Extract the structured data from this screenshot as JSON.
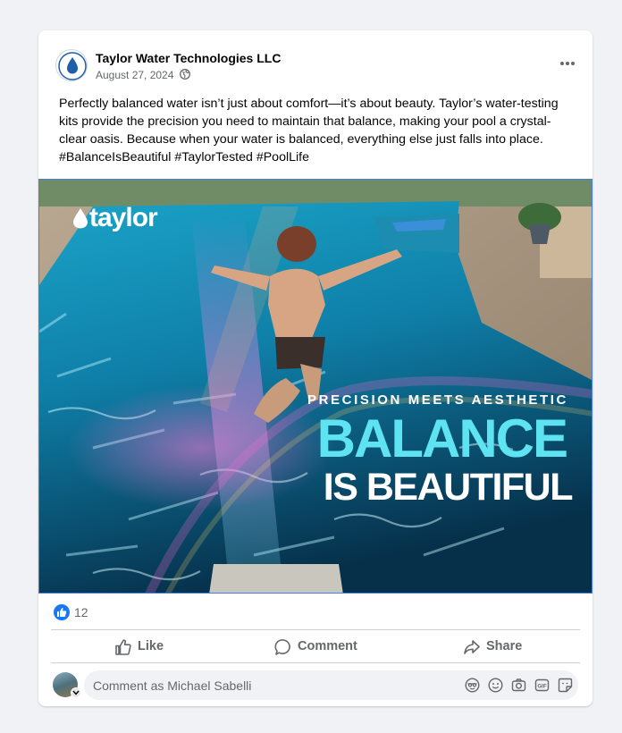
{
  "post": {
    "page_name": "Taylor Water Technologies LLC",
    "date": "August 27, 2024",
    "caption": "Perfectly balanced water isn’t just about comfort—it’s about beauty. Taylor’s water-testing kits provide the precision you need to maintain that balance, making your pool a crystal-clear oasis. Because when your water is balanced, everything else just falls into place. #BalanceIsBeautiful #TaylorTested #PoolLife"
  },
  "image": {
    "logo_text": "taylor",
    "tagline": "PRECISION MEETS AESTHETIC",
    "headline_line1": "BALANCE",
    "headline_line2": "IS BEAUTIFUL"
  },
  "reactions": {
    "like_count": "12"
  },
  "actions": {
    "like": "Like",
    "comment": "Comment",
    "share": "Share"
  },
  "comment_box": {
    "placeholder": "Comment as Michael Sabelli"
  },
  "colors": {
    "facebook_blue": "#1877f2",
    "accent_cyan": "#5ee3f2",
    "secondary_text": "#65676b"
  }
}
